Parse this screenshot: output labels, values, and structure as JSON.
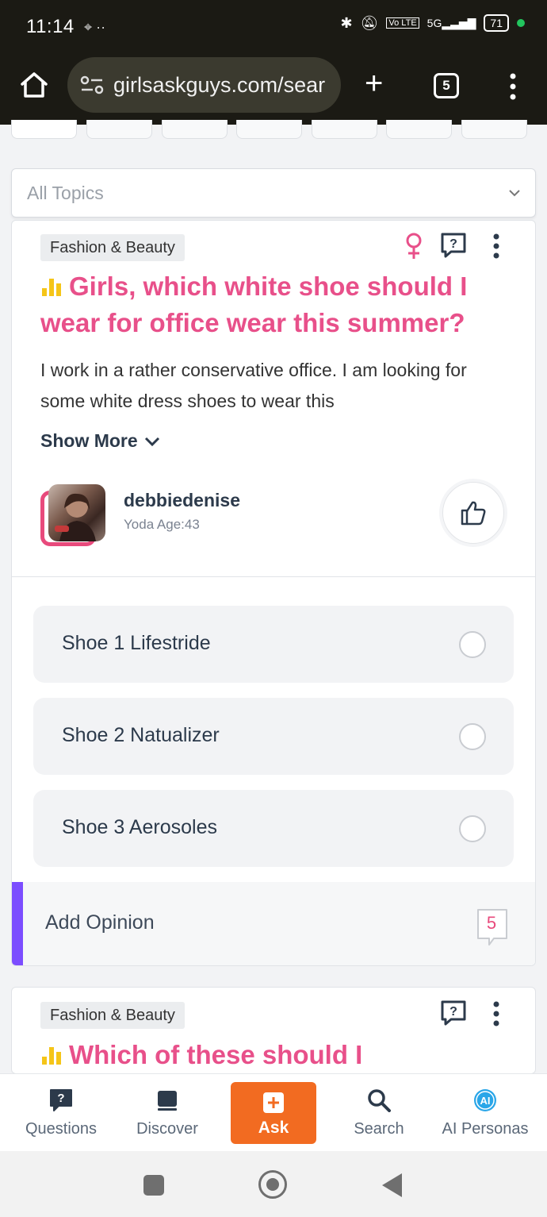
{
  "status_bar": {
    "time": "11:14",
    "left_icons": "⌖ ··",
    "network": "5G",
    "volte": "Vo LTE",
    "battery": "71"
  },
  "browser": {
    "url": "girlsaskguys.com/sear",
    "tab_count": "5"
  },
  "filter": {
    "topic_placeholder": "All Topics"
  },
  "question": {
    "category": "Fashion & Beauty",
    "title": "Girls, which white shoe should I wear for office wear this summer?",
    "body": "I work in a rather conservative office.  I am looking for some white dress shoes to wear this",
    "show_more": "Show More",
    "author": {
      "name": "debbiedenise",
      "info": "Yoda Age:43"
    },
    "options": [
      {
        "label": "Shoe 1 Lifestride"
      },
      {
        "label": "Shoe 2 Natualizer"
      },
      {
        "label": "Shoe 3 Aerosoles"
      }
    ],
    "add_opinion": "Add Opinion",
    "opinion_count": "5"
  },
  "next_question": {
    "category": "Fashion & Beauty",
    "title": "Which of these should I"
  },
  "bottom_nav": {
    "questions": "Questions",
    "discover": "Discover",
    "ask": "Ask",
    "search": "Search",
    "ai_personas": "AI Personas"
  },
  "colors": {
    "accent_pink": "#e8508a",
    "ask_orange": "#f26b21",
    "opinion_bar_purple": "#7c4dff",
    "poll_icon_yellow": "#f5c518",
    "ai_badge_blue": "#2aa6e8"
  }
}
